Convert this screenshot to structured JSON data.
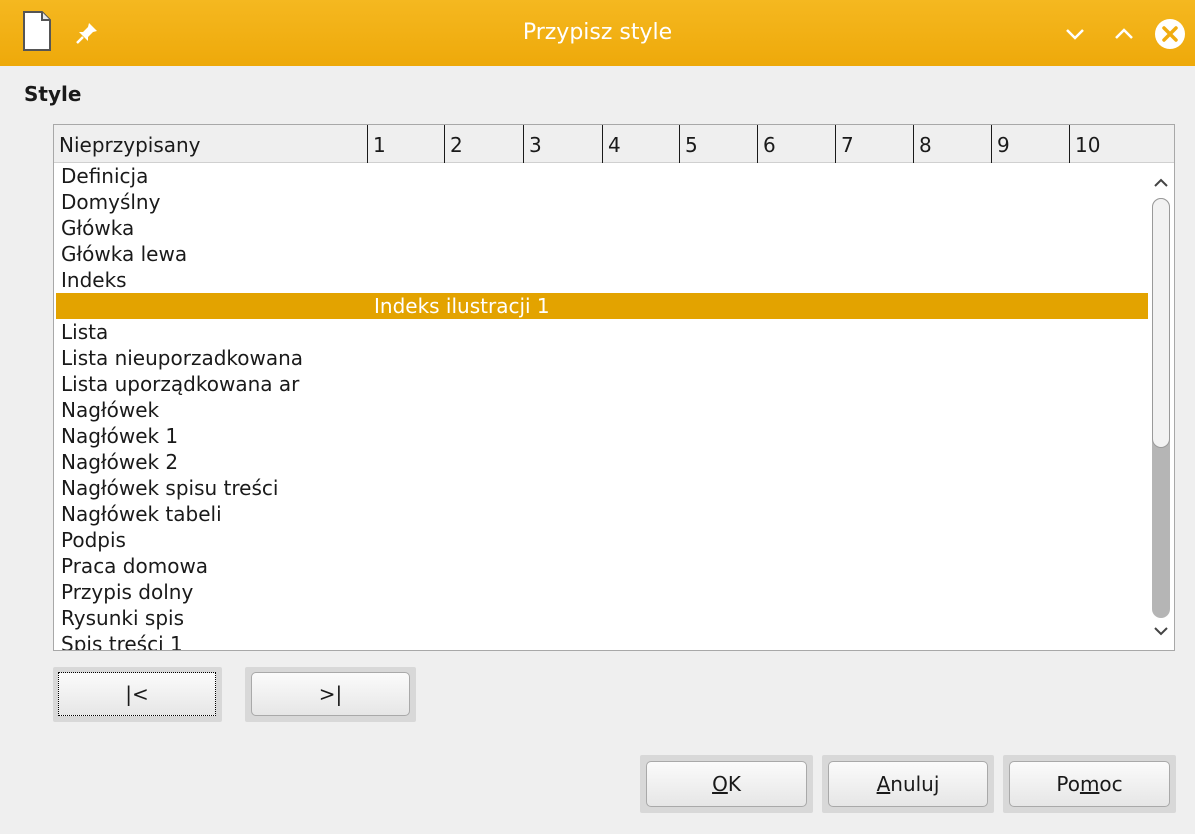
{
  "window": {
    "title": "Przypisz style",
    "icons": [
      "document-icon",
      "pin-icon",
      "chevron-down-icon",
      "chevron-up-icon",
      "close-icon"
    ]
  },
  "section_label": "Style",
  "table": {
    "columns": [
      "Nieprzypisany",
      "1",
      "2",
      "3",
      "4",
      "5",
      "6",
      "7",
      "8",
      "9",
      "10"
    ],
    "rows": [
      {
        "name": "Definicja",
        "level": ""
      },
      {
        "name": "Domyślny",
        "level": ""
      },
      {
        "name": "Główka",
        "level": ""
      },
      {
        "name": "Główka lewa",
        "level": ""
      },
      {
        "name": "Indeks",
        "level": ""
      },
      {
        "name": "",
        "level": "Indeks ilustracji 1",
        "selected": true
      },
      {
        "name": "Lista",
        "level": ""
      },
      {
        "name": "Lista nieuporzadkowana",
        "level": ""
      },
      {
        "name": "Lista uporządkowana ar",
        "level": ""
      },
      {
        "name": "Nagłówek",
        "level": ""
      },
      {
        "name": "Nagłówek 1",
        "level": ""
      },
      {
        "name": "Nagłówek 2",
        "level": ""
      },
      {
        "name": "Nagłówek spisu treści",
        "level": ""
      },
      {
        "name": "Nagłówek tabeli",
        "level": ""
      },
      {
        "name": "Podpis",
        "level": ""
      },
      {
        "name": "Praca domowa",
        "level": ""
      },
      {
        "name": "Przypis dolny",
        "level": ""
      },
      {
        "name": "Rysunki spis",
        "level": ""
      },
      {
        "name": "Spis treści 1",
        "level": ""
      }
    ]
  },
  "nav": {
    "prev_label": "|<",
    "next_label": ">|"
  },
  "buttons": {
    "ok_pre": "",
    "ok_mnemonic": "O",
    "ok_post": "K",
    "cancel_pre": "",
    "cancel_mnemonic": "A",
    "cancel_post": "nuluj",
    "help_pre": "Po",
    "help_mnemonic": "m",
    "help_post": "oc"
  },
  "colors": {
    "titlebar": "#f0ac10",
    "selection": "#e3a300"
  }
}
